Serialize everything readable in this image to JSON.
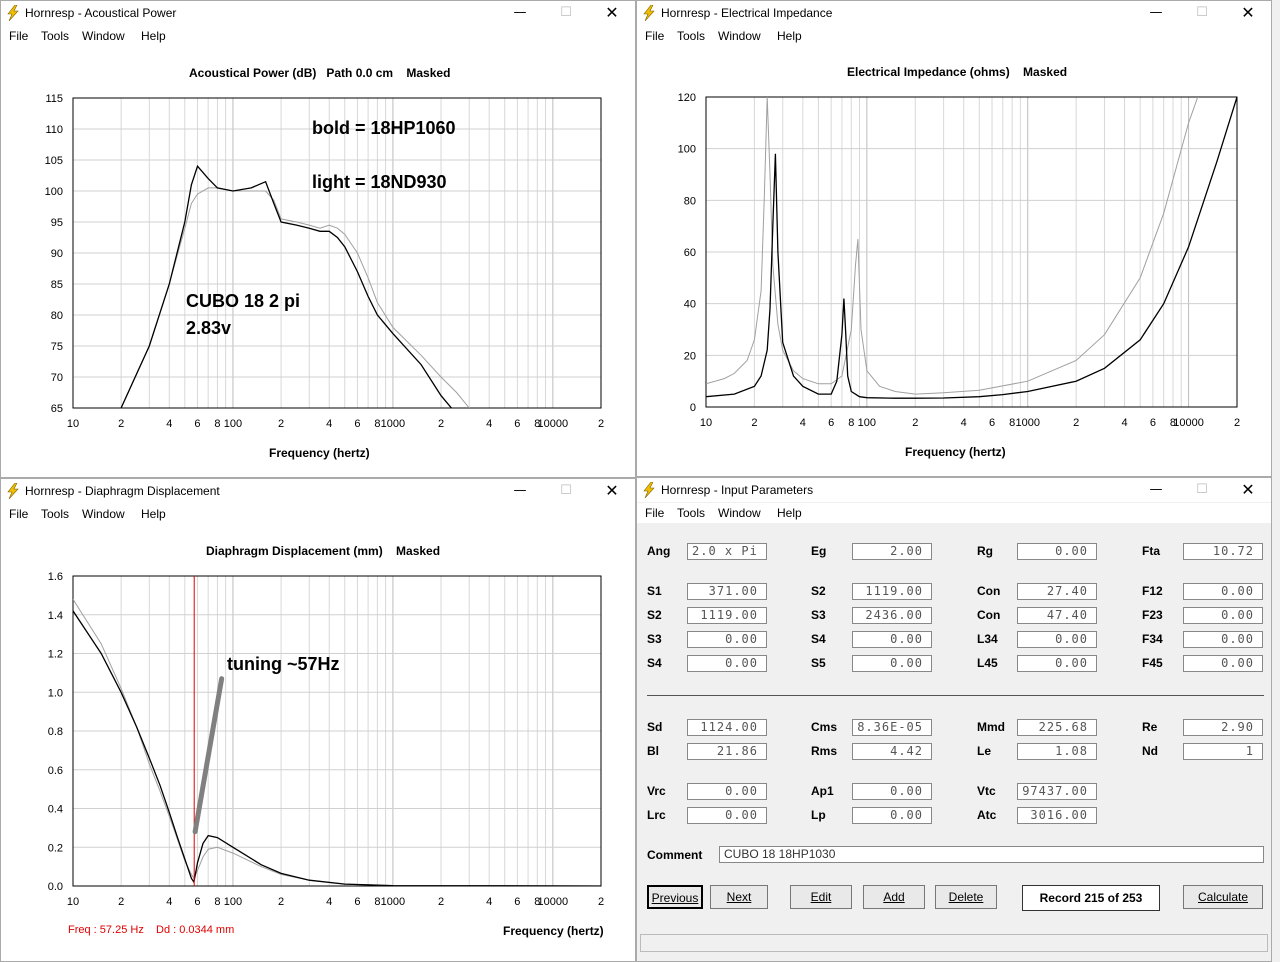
{
  "windows": {
    "power": {
      "title": "Hornresp - Acoustical Power",
      "chart_title": "Acoustical Power (dB)   Path 0.0 cm    Masked",
      "xlabel": "Frequency (hertz)",
      "yticks": [
        "115",
        "110",
        "105",
        "100",
        "95",
        "90",
        "85",
        "80",
        "75",
        "70",
        "65"
      ],
      "xticks": [
        "10",
        "2",
        "4",
        "6",
        "8",
        "100",
        "2",
        "4",
        "6",
        "8",
        "1000",
        "2",
        "4",
        "6",
        "8",
        "10000",
        "2"
      ],
      "annotation1": "bold = 18HP1060",
      "annotation2": "light = 18ND930",
      "annotation3": "CUBO 18  2 pi",
      "annotation4": "2.83v"
    },
    "impedance": {
      "title": "Hornresp - Electrical Impedance",
      "chart_title": "Electrical Impedance (ohms)    Masked",
      "xlabel": "Frequency (hertz)",
      "yticks": [
        "120",
        "100",
        "80",
        "60",
        "40",
        "20",
        "0"
      ],
      "xticks": [
        "10",
        "2",
        "4",
        "6",
        "8",
        "100",
        "2",
        "4",
        "6",
        "8",
        "1000",
        "2",
        "4",
        "6",
        "8",
        "10000",
        "2"
      ]
    },
    "displacement": {
      "title": "Hornresp - Diaphragm Displacement",
      "chart_title": "Diaphragm Displacement (mm)    Masked",
      "xlabel": "Frequency (hertz)",
      "yticks": [
        "1.6",
        "1.4",
        "1.2",
        "1.0",
        "0.8",
        "0.6",
        "0.4",
        "0.2",
        "0.0"
      ],
      "xticks": [
        "10",
        "2",
        "4",
        "6",
        "8",
        "100",
        "2",
        "4",
        "6",
        "8",
        "1000",
        "2",
        "4",
        "6",
        "8",
        "10000",
        "2"
      ],
      "annotation": "tuning ~57Hz",
      "status_freq": "Freq : 57.25 Hz",
      "status_dd": "Dd : 0.0344 mm"
    },
    "params": {
      "title": "Hornresp - Input Parameters",
      "rows": [
        [
          [
            "Ang",
            "2.0 x Pi"
          ],
          [
            "Eg",
            "2.00"
          ],
          [
            "Rg",
            "0.00"
          ],
          [
            "Fta",
            "10.72"
          ]
        ],
        [
          [
            "S1",
            "371.00"
          ],
          [
            "S2",
            "1119.00"
          ],
          [
            "Con",
            "27.40"
          ],
          [
            "F12",
            "0.00"
          ]
        ],
        [
          [
            "S2",
            "1119.00"
          ],
          [
            "S3",
            "2436.00"
          ],
          [
            "Con",
            "47.40"
          ],
          [
            "F23",
            "0.00"
          ]
        ],
        [
          [
            "S3",
            "0.00"
          ],
          [
            "S4",
            "0.00"
          ],
          [
            "L34",
            "0.00"
          ],
          [
            "F34",
            "0.00"
          ]
        ],
        [
          [
            "S4",
            "0.00"
          ],
          [
            "S5",
            "0.00"
          ],
          [
            "L45",
            "0.00"
          ],
          [
            "F45",
            "0.00"
          ]
        ],
        [
          [
            "Sd",
            "1124.00"
          ],
          [
            "Cms",
            "8.36E-05"
          ],
          [
            "Mmd",
            "225.68"
          ],
          [
            "Re",
            "2.90"
          ]
        ],
        [
          [
            "Bl",
            "21.86"
          ],
          [
            "Rms",
            "4.42"
          ],
          [
            "Le",
            "1.08"
          ],
          [
            "Nd",
            "1"
          ]
        ],
        [
          [
            "Vrc",
            "0.00"
          ],
          [
            "Ap1",
            "0.00"
          ],
          [
            "Vtc",
            "97437.00"
          ]
        ],
        [
          [
            "Lrc",
            "0.00"
          ],
          [
            "Lp",
            "0.00"
          ],
          [
            "Atc",
            "3016.00"
          ]
        ]
      ],
      "comment_label": "Comment",
      "comment": "CUBO 18 18HP1030",
      "buttons": {
        "previous": "Previous",
        "next": "Next",
        "edit": "Edit",
        "add": "Add",
        "delete": "Delete",
        "calculate": "Calculate"
      },
      "record": "Record 215 of 253"
    }
  },
  "menu": {
    "file": "File",
    "tools": "Tools",
    "window": "Window",
    "help": "Help"
  },
  "colors": {
    "marker": "#e00000",
    "annotation_line": "#808080",
    "curve_bold": "#000000",
    "curve_light": "#a0a0a0"
  },
  "chart_data": [
    {
      "type": "line",
      "title": "Acoustical Power (dB)   Path 0.0 cm    Masked",
      "xlabel": "Frequency (hertz)",
      "xscale": "log",
      "xlim": [
        10,
        20000
      ],
      "ylim": [
        65,
        115
      ],
      "series": [
        {
          "name": "bold = 18HP1060",
          "x": [
            20,
            30,
            40,
            50,
            55,
            60,
            70,
            80,
            100,
            130,
            160,
            180,
            200,
            250,
            300,
            350,
            400,
            450,
            500,
            600,
            700,
            800,
            1000,
            1500,
            2000,
            2500,
            3000,
            3500
          ],
          "y": [
            65,
            75,
            85,
            95,
            101,
            104,
            102,
            100.5,
            100,
            100.5,
            101.5,
            98,
            95,
            94.5,
            94,
            93.5,
            93.5,
            92.5,
            91,
            87,
            83,
            80,
            77,
            72,
            67,
            64,
            60,
            56
          ]
        },
        {
          "name": "light = 18ND930",
          "x": [
            20,
            30,
            40,
            50,
            55,
            60,
            70,
            80,
            100,
            130,
            160,
            180,
            200,
            250,
            300,
            350,
            400,
            450,
            500,
            600,
            700,
            800,
            1000,
            1500,
            2000,
            2500,
            3000,
            3500,
            4000
          ],
          "y": [
            65,
            75,
            85,
            94,
            98,
            99.5,
            100.5,
            100.5,
            100,
            100,
            100,
            98.5,
            95.5,
            95,
            94.5,
            94,
            94.5,
            94,
            93,
            90,
            86,
            82,
            78,
            73.5,
            70,
            67.5,
            65,
            62,
            58
          ]
        }
      ]
    },
    {
      "type": "line",
      "title": "Electrical Impedance (ohms)    Masked",
      "xlabel": "Frequency (hertz)",
      "xscale": "log",
      "xlim": [
        10,
        20000
      ],
      "ylim": [
        0,
        120
      ],
      "series": [
        {
          "name": "bold = 18HP1060",
          "x": [
            10,
            15,
            20,
            22,
            24,
            25,
            26,
            27,
            28,
            30,
            35,
            40,
            50,
            60,
            65,
            70,
            72,
            74,
            76,
            80,
            90,
            100,
            150,
            200,
            300,
            500,
            700,
            1000,
            2000,
            3000,
            5000,
            7000,
            10000,
            15000,
            20000
          ],
          "y": [
            4,
            5,
            8,
            12,
            22,
            38,
            70,
            98,
            60,
            25,
            12,
            8,
            5,
            5,
            10,
            28,
            42,
            28,
            12,
            6,
            4,
            3.6,
            3.4,
            3.4,
            3.5,
            4,
            4.8,
            6,
            10,
            15,
            26,
            40,
            62,
            95,
            120
          ]
        },
        {
          "name": "light = 18ND930",
          "x": [
            10,
            13,
            15,
            18,
            20,
            22,
            23,
            24,
            25,
            26,
            28,
            30,
            35,
            40,
            50,
            60,
            70,
            80,
            85,
            88,
            92,
            100,
            120,
            150,
            200,
            300,
            500,
            1000,
            2000,
            3000,
            5000,
            7000,
            10000,
            13000
          ],
          "y": [
            9,
            11,
            13,
            18,
            26,
            45,
            80,
            120,
            90,
            55,
            32,
            22,
            14,
            11,
            9,
            9,
            12,
            30,
            55,
            65,
            30,
            14,
            8,
            6,
            5,
            5.5,
            6.5,
            10,
            18,
            28,
            50,
            75,
            110,
            130
          ]
        }
      ]
    },
    {
      "type": "line",
      "title": "Diaphragm Displacement (mm)    Masked",
      "xlabel": "Frequency (hertz)",
      "xscale": "log",
      "xlim": [
        10,
        20000
      ],
      "ylim": [
        0,
        1.6
      ],
      "series": [
        {
          "name": "bold = 18HP1060",
          "x": [
            10,
            15,
            20,
            25,
            30,
            35,
            40,
            45,
            50,
            55,
            57,
            60,
            65,
            70,
            80,
            100,
            150,
            200,
            300,
            500,
            1000,
            20000
          ],
          "y": [
            1.42,
            1.2,
            1.0,
            0.82,
            0.66,
            0.52,
            0.38,
            0.25,
            0.14,
            0.04,
            0.02,
            0.12,
            0.22,
            0.26,
            0.25,
            0.2,
            0.11,
            0.065,
            0.03,
            0.01,
            0.002,
            0
          ]
        },
        {
          "name": "light = 18ND930",
          "x": [
            10,
            15,
            20,
            25,
            30,
            35,
            40,
            45,
            50,
            55,
            57,
            60,
            65,
            70,
            80,
            100,
            150,
            200,
            300,
            500,
            1000,
            20000
          ],
          "y": [
            1.48,
            1.25,
            1.02,
            0.82,
            0.63,
            0.49,
            0.36,
            0.24,
            0.13,
            0.06,
            0.04,
            0.08,
            0.15,
            0.19,
            0.2,
            0.17,
            0.1,
            0.06,
            0.03,
            0.01,
            0.002,
            0
          ]
        }
      ],
      "marker_x": 57.25
    }
  ]
}
